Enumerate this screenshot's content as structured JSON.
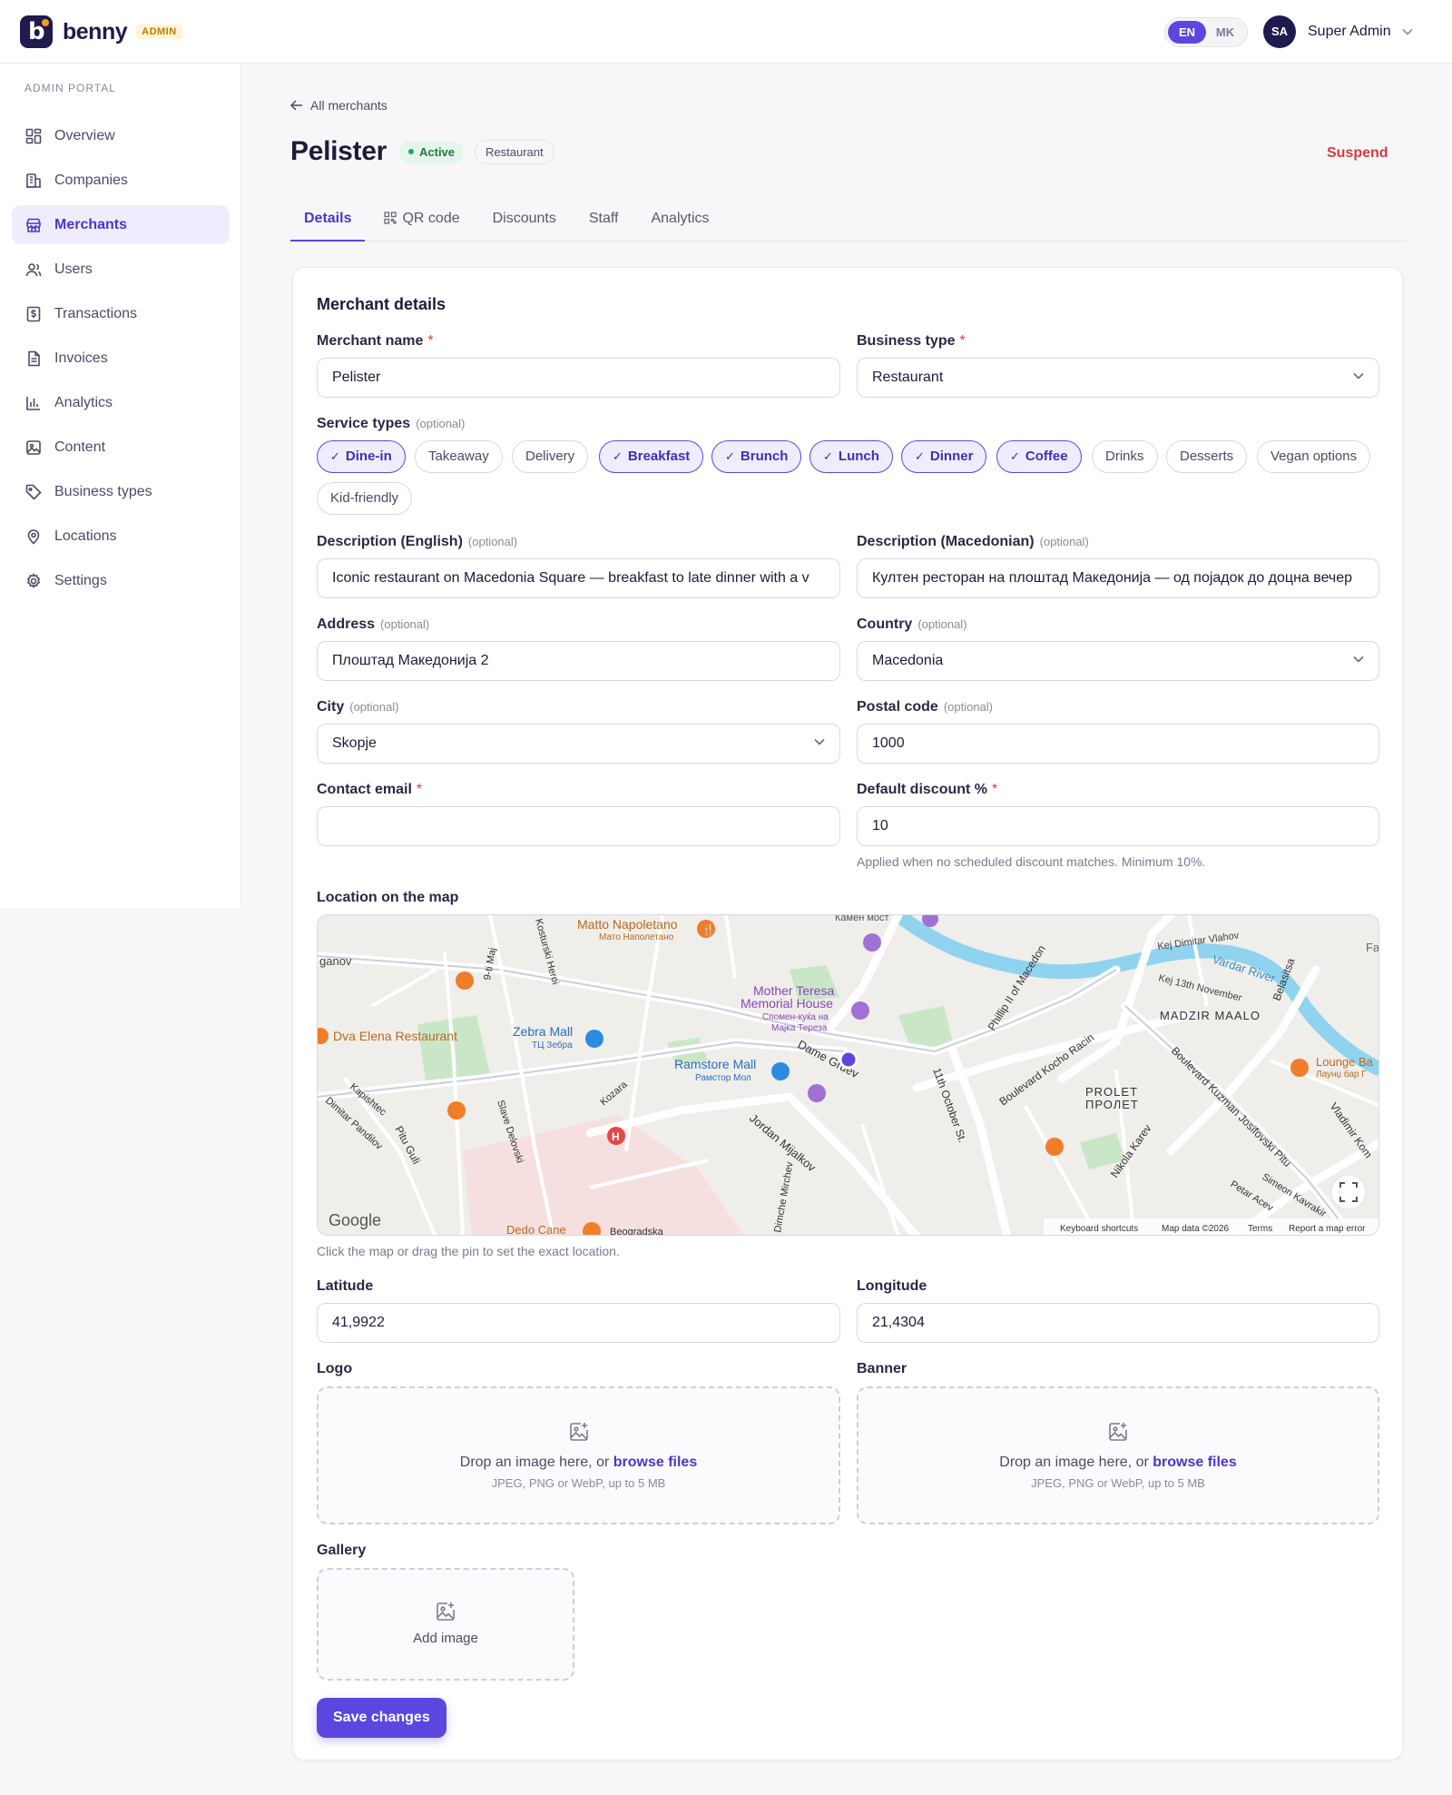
{
  "brand": {
    "name": "benny",
    "badge": "ADMIN",
    "logo_letter": "b"
  },
  "lang": {
    "en": "EN",
    "mk": "MK",
    "active": "EN"
  },
  "user": {
    "initials": "SA",
    "name": "Super Admin"
  },
  "sidebar": {
    "section": "ADMIN PORTAL",
    "items": [
      {
        "label": "Overview",
        "icon": "grid-icon"
      },
      {
        "label": "Companies",
        "icon": "building-icon"
      },
      {
        "label": "Merchants",
        "icon": "store-icon",
        "active": true
      },
      {
        "label": "Users",
        "icon": "users-icon"
      },
      {
        "label": "Transactions",
        "icon": "dollar-doc-icon"
      },
      {
        "label": "Invoices",
        "icon": "file-icon"
      },
      {
        "label": "Analytics",
        "icon": "bar-chart-icon"
      },
      {
        "label": "Content",
        "icon": "image-icon"
      },
      {
        "label": "Business types",
        "icon": "tag-icon"
      },
      {
        "label": "Locations",
        "icon": "map-pin-icon"
      },
      {
        "label": "Settings",
        "icon": "gear-icon"
      }
    ]
  },
  "page": {
    "back_label": "All merchants",
    "title": "Pelister",
    "status": "Active",
    "type_badge": "Restaurant",
    "suspend_label": "Suspend"
  },
  "tabs": [
    "Details",
    "QR code",
    "Discounts",
    "Staff",
    "Analytics"
  ],
  "form": {
    "section_title": "Merchant details",
    "required_mark": "*",
    "optional_text": "(optional)",
    "merchant_name": {
      "label": "Merchant name",
      "value": "Pelister"
    },
    "business_type": {
      "label": "Business type",
      "value": "Restaurant"
    },
    "service_types": {
      "label": "Service types",
      "options": [
        {
          "label": "Dine-in",
          "selected": true
        },
        {
          "label": "Takeaway",
          "selected": false
        },
        {
          "label": "Delivery",
          "selected": false
        },
        {
          "label": "Breakfast",
          "selected": true
        },
        {
          "label": "Brunch",
          "selected": true
        },
        {
          "label": "Lunch",
          "selected": true
        },
        {
          "label": "Dinner",
          "selected": true
        },
        {
          "label": "Coffee",
          "selected": true
        },
        {
          "label": "Drinks",
          "selected": false
        },
        {
          "label": "Desserts",
          "selected": false
        },
        {
          "label": "Vegan options",
          "selected": false
        },
        {
          "label": "Kid-friendly",
          "selected": false
        }
      ]
    },
    "description_en": {
      "label": "Description (English)",
      "value": "Iconic restaurant on Macedonia Square — breakfast to late dinner with a v"
    },
    "description_mk": {
      "label": "Description (Macedonian)",
      "value": "Култен ресторан на плоштад Македонија — од појадок до доцна вечер"
    },
    "address": {
      "label": "Address",
      "value": "Плоштад Македонија 2"
    },
    "country": {
      "label": "Country",
      "value": "Macedonia"
    },
    "city": {
      "label": "City",
      "value": "Skopje"
    },
    "postal_code": {
      "label": "Postal code",
      "value": "1000"
    },
    "contact_email": {
      "label": "Contact email",
      "value": ""
    },
    "default_discount": {
      "label": "Default discount %",
      "value": "10",
      "help": "Applied when no scheduled discount matches. Minimum 10%."
    },
    "map": {
      "label": "Location on the map",
      "help": "Click the map or drag the pin to set the exact location.",
      "google": "Google",
      "footer": [
        "Keyboard shortcuts",
        "Map data ©2026",
        "Terms",
        "Report a map error"
      ],
      "labels": {
        "matto": "Matto Napoletano",
        "matto_mk": "Мато Наполетано",
        "kamen": "Камен мост",
        "ganov": "ganov",
        "dva_elena": "Dva Elena Restaurant",
        "zebra": "Zebra Mall",
        "zebra_mk": "ТЦ Зебра",
        "mother1": "Mother Teresa",
        "mother2": "Memorial House",
        "mother_mk1": "Спомен-куќа на",
        "mother_mk2": "Мајка Тереза",
        "ramstore": "Ramstore Mall",
        "ramstore_mk": "Рамстор Мол",
        "dame": "Dame Gruev",
        "vardar": "Vardar River",
        "kej1": "Kej Dimitar Vlahov",
        "kej2": "Kej 13th November",
        "madzir": "MADZIR MAALO",
        "belasitsa": "Belasitsa",
        "lounge": "Lounge Ba",
        "lounge_mk": "Лаунџ бар Г",
        "prolet": "PROLET",
        "prolet_mk": "ПРОЛЕТ",
        "phillip": "Phillip II of Macedon",
        "kocho": "Boulevard Kocho Racin",
        "oct": "11th October St.",
        "jordan": "Jordan Mijalkov",
        "kozara": "Kozara",
        "kuzman": "Boulevard Kuzman Josifovski Pitu",
        "nikola": "Nikola Karev",
        "simeon": "Simeon Kavrakir",
        "petar": "Petar Acev",
        "vladimir": "Vladimir Kom",
        "dedo": "Dedo Cane",
        "beogradska": "Beogradska",
        "kapishtec": "Kapishtec",
        "dimitar": "Dimitar Pandilov",
        "pitu": "Pitu Guli",
        "slave": "Slave Delovski",
        "ilinden": "9-ti Maj",
        "kosturski": "Kosturski Heroi",
        "mirchev": "Dimche Mirchev",
        "fa": "Fa"
      }
    },
    "latitude": {
      "label": "Latitude",
      "value": "41,9922"
    },
    "longitude": {
      "label": "Longitude",
      "value": "21,4304"
    },
    "logo": {
      "label": "Logo",
      "drop_text": "Drop an image here, or",
      "browse": "browse files",
      "sub": "JPEG, PNG or WebP, up to 5 MB"
    },
    "banner": {
      "label": "Banner",
      "drop_text": "Drop an image here, or",
      "browse": "browse files",
      "sub": "JPEG, PNG or WebP, up to 5 MB"
    },
    "gallery": {
      "label": "Gallery",
      "add": "Add image"
    },
    "save_label": "Save changes"
  },
  "colors": {
    "accent": "#5b47e0",
    "danger": "#d63b3b",
    "success": "#2aa555",
    "brand_dark": "#1f1b4d"
  }
}
